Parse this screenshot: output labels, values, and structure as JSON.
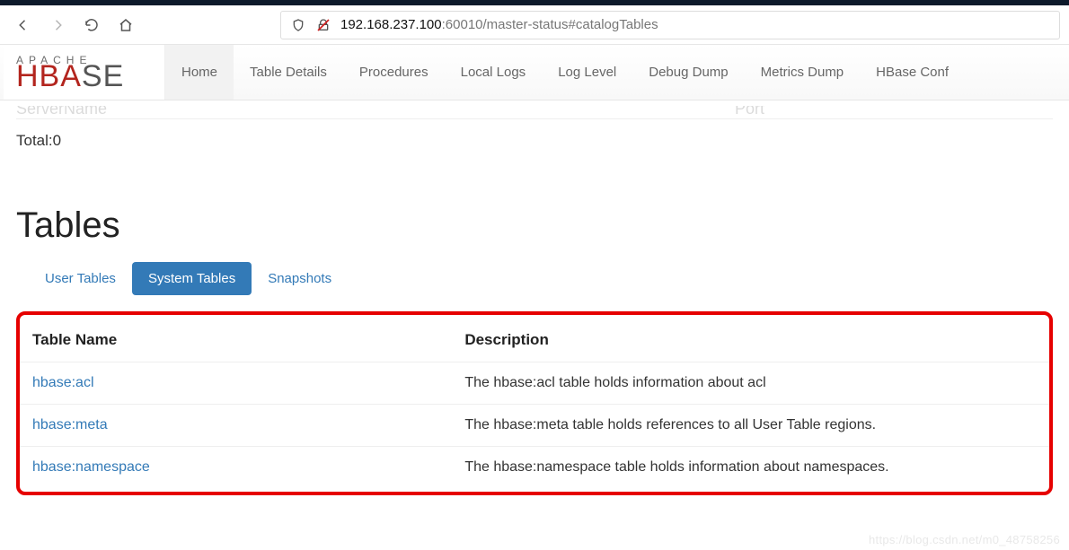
{
  "browser": {
    "url_prefix": "192.168.237.100",
    "url_suffix": ":60010/master-status#catalogTables"
  },
  "brand": {
    "apache": "APACHE",
    "name_red": "HBA",
    "name_grey": "SE"
  },
  "nav": {
    "items": [
      {
        "label": "Home",
        "active": true
      },
      {
        "label": "Table Details",
        "active": false
      },
      {
        "label": "Procedures",
        "active": false
      },
      {
        "label": "Local Logs",
        "active": false
      },
      {
        "label": "Log Level",
        "active": false
      },
      {
        "label": "Debug Dump",
        "active": false
      },
      {
        "label": "Metrics Dump",
        "active": false
      },
      {
        "label": "HBase Conf",
        "active": false
      }
    ]
  },
  "server_summary": {
    "left_header": "ServerName",
    "right_header": "Port",
    "total_label": "Total:0"
  },
  "tables_section": {
    "title": "Tables",
    "tabs": [
      {
        "label": "User Tables",
        "active": false
      },
      {
        "label": "System Tables",
        "active": true
      },
      {
        "label": "Snapshots",
        "active": false
      }
    ],
    "columns": {
      "name": "Table Name",
      "desc": "Description"
    },
    "rows": [
      {
        "name": "hbase:acl",
        "desc": "The hbase:acl table holds information about acl"
      },
      {
        "name": "hbase:meta",
        "desc": "The hbase:meta table holds references to all User Table regions."
      },
      {
        "name": "hbase:namespace",
        "desc": "The hbase:namespace table holds information about namespaces."
      }
    ]
  },
  "watermark": "https://blog.csdn.net/m0_48758256"
}
